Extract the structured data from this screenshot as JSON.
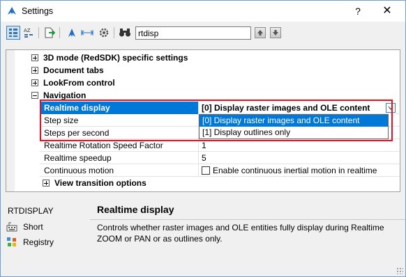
{
  "window": {
    "title": "Settings",
    "help_label": "?",
    "close_label": "✕"
  },
  "toolbar": {
    "search_value": "rtdisp"
  },
  "tree": {
    "groups": [
      {
        "label": "3D mode (RedSDK) specific settings",
        "state": "collapsed"
      },
      {
        "label": "Document tabs",
        "state": "collapsed"
      },
      {
        "label": "LookFrom control",
        "state": "collapsed"
      },
      {
        "label": "Navigation",
        "state": "expanded"
      }
    ],
    "properties": [
      {
        "name": "Realtime display",
        "value": "[0] Display raster images and OLE content"
      },
      {
        "name": "Step size",
        "value": ""
      },
      {
        "name": "Steps per second",
        "value": ""
      },
      {
        "name": "Realtime Rotation Speed Factor",
        "value": "1"
      },
      {
        "name": "Realtime speedup",
        "value": "5"
      },
      {
        "name": "Continuous motion",
        "value": "Enable continuous inertial motion in realtime"
      }
    ],
    "subgroup": {
      "label": "View transition options",
      "state": "collapsed"
    },
    "dropdown_options": [
      "[0] Display raster images and OLE content",
      "[1] Display outlines only"
    ]
  },
  "info": {
    "command": "RTDISPLAY",
    "links": [
      "Short",
      "Registry"
    ],
    "title": "Realtime display",
    "description": "Controls whether raster images and OLE entities fully display during Realtime ZOOM or PAN or as outlines only."
  },
  "colors": {
    "selection": "#0078d7",
    "highlight_box": "#e81123"
  }
}
